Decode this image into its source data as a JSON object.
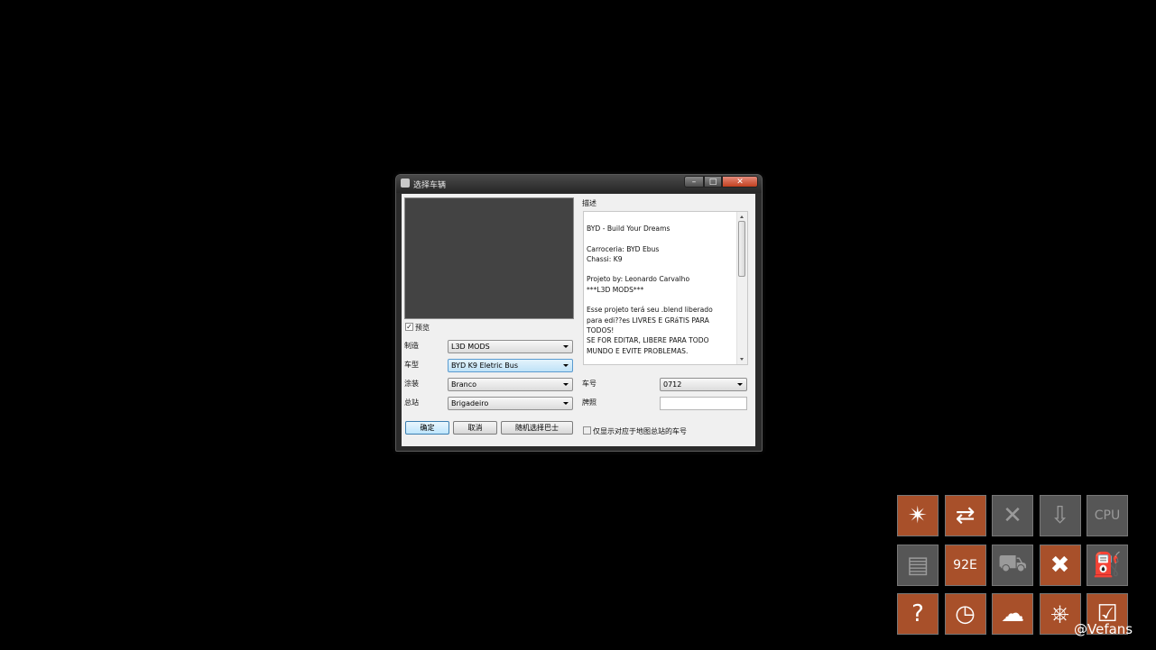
{
  "window": {
    "title": "选择车辆",
    "min_glyph": "–",
    "max_glyph": "□",
    "close_glyph": "✕"
  },
  "form": {
    "preview_label": "预览",
    "preview_checked": true,
    "manufacturer_label": "制造",
    "manufacturer_value": "L3D MODS",
    "model_label": "车型",
    "model_value": "BYD K9 Eletric Bus",
    "livery_label": "涂装",
    "livery_value": "Branco",
    "depot_label": "总站",
    "depot_value": "Brigadeiro",
    "fleet_number_label": "车号",
    "fleet_number_value": "0712",
    "plate_label": "牌照",
    "plate_value": "",
    "ok_label": "确定",
    "cancel_label": "取消",
    "random_label": "随机选择巴士",
    "only_depot_label": "仅显示对应于地图总站的车号",
    "only_depot_checked": false
  },
  "description": {
    "label": "描述",
    "text": "BYD - Build Your Dreams\n\nCarroceria: BYD Ebus\nChassi: K9\n\nProjeto by: Leonardo Carvalho\n***L3D MODS***\n\nEsse projeto terá seu .blend liberado\npara edi??es LIVRES E GRáTIS PARA\nTODOS!\nSE FOR EDITAR, LIBERE PARA TODO\nMUNDO E EVITE PROBLEMAS."
  },
  "toolbar": {
    "tiles": [
      {
        "name": "bus-doors-icon",
        "glyph": "✴",
        "style": "orange"
      },
      {
        "name": "bus-swap-icon",
        "glyph": "⇄",
        "style": "orange"
      },
      {
        "name": "bus-remove-icon",
        "glyph": "✕",
        "style": "gray"
      },
      {
        "name": "bus-arrow-down-icon",
        "glyph": "⇩",
        "style": "gray"
      },
      {
        "name": "cpu-bus-icon",
        "glyph": "CPU",
        "style": "gray"
      },
      {
        "name": "ticket-printer-icon",
        "glyph": "▤",
        "style": "gray"
      },
      {
        "name": "route-display-icon",
        "glyph": "92E",
        "style": "orange"
      },
      {
        "name": "traffic-car-icon",
        "glyph": "⛟",
        "style": "gray"
      },
      {
        "name": "repair-tools-icon",
        "glyph": "✖",
        "style": "orange"
      },
      {
        "name": "fuel-station-icon",
        "glyph": "⛽",
        "style": "gray"
      },
      {
        "name": "help-icon",
        "glyph": "?",
        "style": "orange"
      },
      {
        "name": "clock-icon",
        "glyph": "◷",
        "style": "orange"
      },
      {
        "name": "weather-icon",
        "glyph": "☁",
        "style": "orange"
      },
      {
        "name": "steering-wheel-icon",
        "glyph": "⎈",
        "style": "orange"
      },
      {
        "name": "timetable-icon",
        "glyph": "☑",
        "style": "orange"
      }
    ],
    "watermark": "@Vefans"
  }
}
